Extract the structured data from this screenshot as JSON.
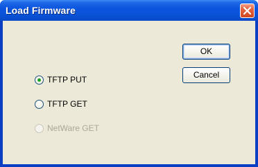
{
  "window": {
    "title": "Load Firmware"
  },
  "buttons": {
    "ok_label": "OK",
    "cancel_label": "Cancel"
  },
  "options": [
    {
      "label": "TFTP PUT",
      "selected": true,
      "enabled": true
    },
    {
      "label": "TFTP GET",
      "selected": false,
      "enabled": true
    },
    {
      "label": "NetWare GET",
      "selected": false,
      "enabled": false
    }
  ],
  "icons": {
    "close": "close-icon"
  },
  "colors": {
    "titlebar": "#0853d8",
    "dialog_background": "#ece9d8",
    "close_button": "#d0461f",
    "radio_selected_dot": "#21a121",
    "disabled_text": "#aca899"
  }
}
